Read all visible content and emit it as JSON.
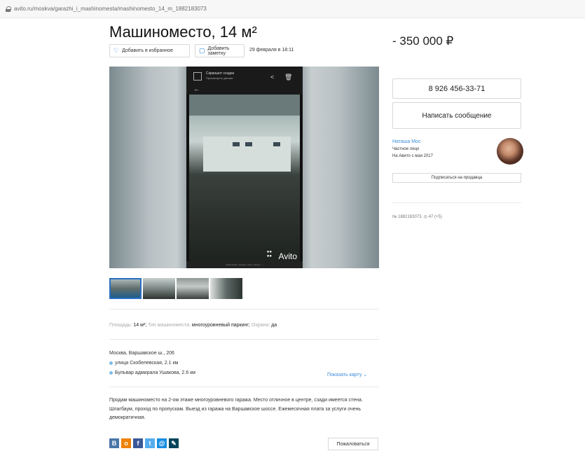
{
  "url": "avito.ru/moskva/garazhi_i_mashinomesta/mashinomesto_14_m_1882183073",
  "title": "Машиноместо, 14 м²",
  "price": "- 350 000 ₽",
  "actions": {
    "favorite": "Добавить в избранное",
    "note": "Добавить заметку",
    "date": "29 февраля в 18:11"
  },
  "photo": {
    "screenshot_title": "Скриншот создан",
    "screenshot_sub": "Просмотреть детали",
    "watermark": "Avito",
    "footer": "Нарисовано, видимо, много общего ⋯"
  },
  "params": [
    {
      "label": "Площадь:",
      "value": "14 м²;"
    },
    {
      "label": "Тип машиноместа:",
      "value": "многоуровневый паркинг;"
    },
    {
      "label": "Охрана:",
      "value": "да"
    }
  ],
  "address": {
    "line": "Москва, Варшавское ш., 206",
    "metro": [
      {
        "name": "улица Скобелевская, 2.1 км",
        "color": "#7fbde6"
      },
      {
        "name": "Бульвар адмирала Ушакова, 2.6 км",
        "color": "#7fbde6"
      }
    ],
    "map_link": "Показать карту ⌄"
  },
  "description": "Продам машиноместо на 2-ом этаже многоуровневого гаража. Место отличное в центре, сзади имеется стена. Шлагбаум, проход по пропускам. Выезд из гаража на Варшавское шоссе. Ежемесячная плата за услуги очень демократичная.",
  "socials": [
    {
      "icon": "vk-icon",
      "glyph": "В",
      "color": "#4a76a8"
    },
    {
      "icon": "ok-icon",
      "glyph": "о",
      "color": "#ee8208"
    },
    {
      "icon": "facebook-icon",
      "glyph": "f",
      "color": "#3b5998"
    },
    {
      "icon": "twitter-icon",
      "glyph": "t",
      "color": "#55acee"
    },
    {
      "icon": "mail-icon",
      "glyph": "@",
      "color": "#168de2"
    },
    {
      "icon": "lj-icon",
      "glyph": "✎",
      "color": "#004359"
    }
  ],
  "complain": "Пожаловаться",
  "phone": "8 926 456-33-71",
  "message": "Написать сообщение",
  "seller": {
    "name": "Наташа Мос",
    "type": "Частное лицо",
    "since": "На Авито с мая 2017",
    "subscribe": "Подписаться на продавца"
  },
  "stats": "№ 1882183073, ◎ 47 (+5)"
}
